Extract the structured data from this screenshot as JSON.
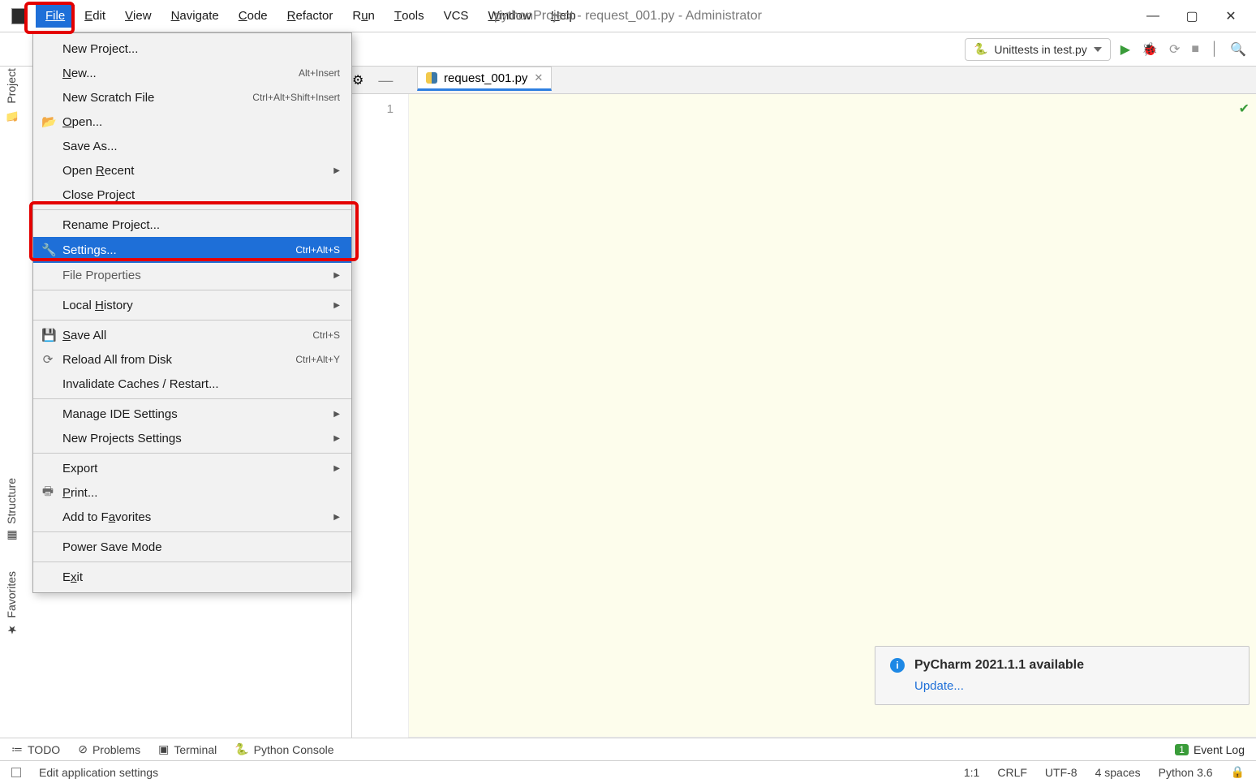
{
  "title": "pythonProject - request_001.py - Administrator",
  "menubar": {
    "file": "File",
    "edit": "dit",
    "view": "View",
    "navigate": "Navigate",
    "code": "Code",
    "refactor": "Refactor",
    "run": "Run",
    "tools": "Tools",
    "vcs": "VCS",
    "window": "Window",
    "help": "Help"
  },
  "run_config": "Unittests in test.py",
  "file_tab": "request_001.py",
  "editor_line": "1",
  "dropdown": {
    "new_project": "New Project...",
    "new": "New...",
    "new_shortcut": "Alt+Insert",
    "new_scratch": "New Scratch File",
    "new_scratch_shortcut": "Ctrl+Alt+Shift+Insert",
    "open": "Open...",
    "save_as": "Save As...",
    "open_recent": "Open Recent",
    "close_project": "Close Project",
    "rename_project": "Rename Project...",
    "settings": "Settings...",
    "settings_shortcut": "Ctrl+Alt+S",
    "file_properties": "File Properties",
    "local_history": "Local History",
    "save_all": "Save All",
    "save_all_shortcut": "Ctrl+S",
    "reload": "Reload All from Disk",
    "reload_shortcut": "Ctrl+Alt+Y",
    "invalidate": "Invalidate Caches / Restart...",
    "manage_ide": "Manage IDE Settings",
    "new_projects_settings": "New Projects Settings",
    "export": "Export",
    "print": "Print...",
    "add_favorites": "Add to Favorites",
    "power_save": "Power Save Mode",
    "exit": "Exit"
  },
  "sidetabs": {
    "project": "Project",
    "structure": "Structure",
    "favorites": "Favorites"
  },
  "notification": {
    "title": "PyCharm 2021.1.1 available",
    "link": "Update..."
  },
  "bottom": {
    "todo": "TODO",
    "problems": "Problems",
    "terminal": "Terminal",
    "python_console": "Python Console",
    "event_log": "Event Log",
    "event_badge": "1"
  },
  "status": {
    "hint": "Edit application settings",
    "pos": "1:1",
    "line_sep": "CRLF",
    "encoding": "UTF-8",
    "indent": "4 spaces",
    "interpreter": "Python 3.6"
  }
}
